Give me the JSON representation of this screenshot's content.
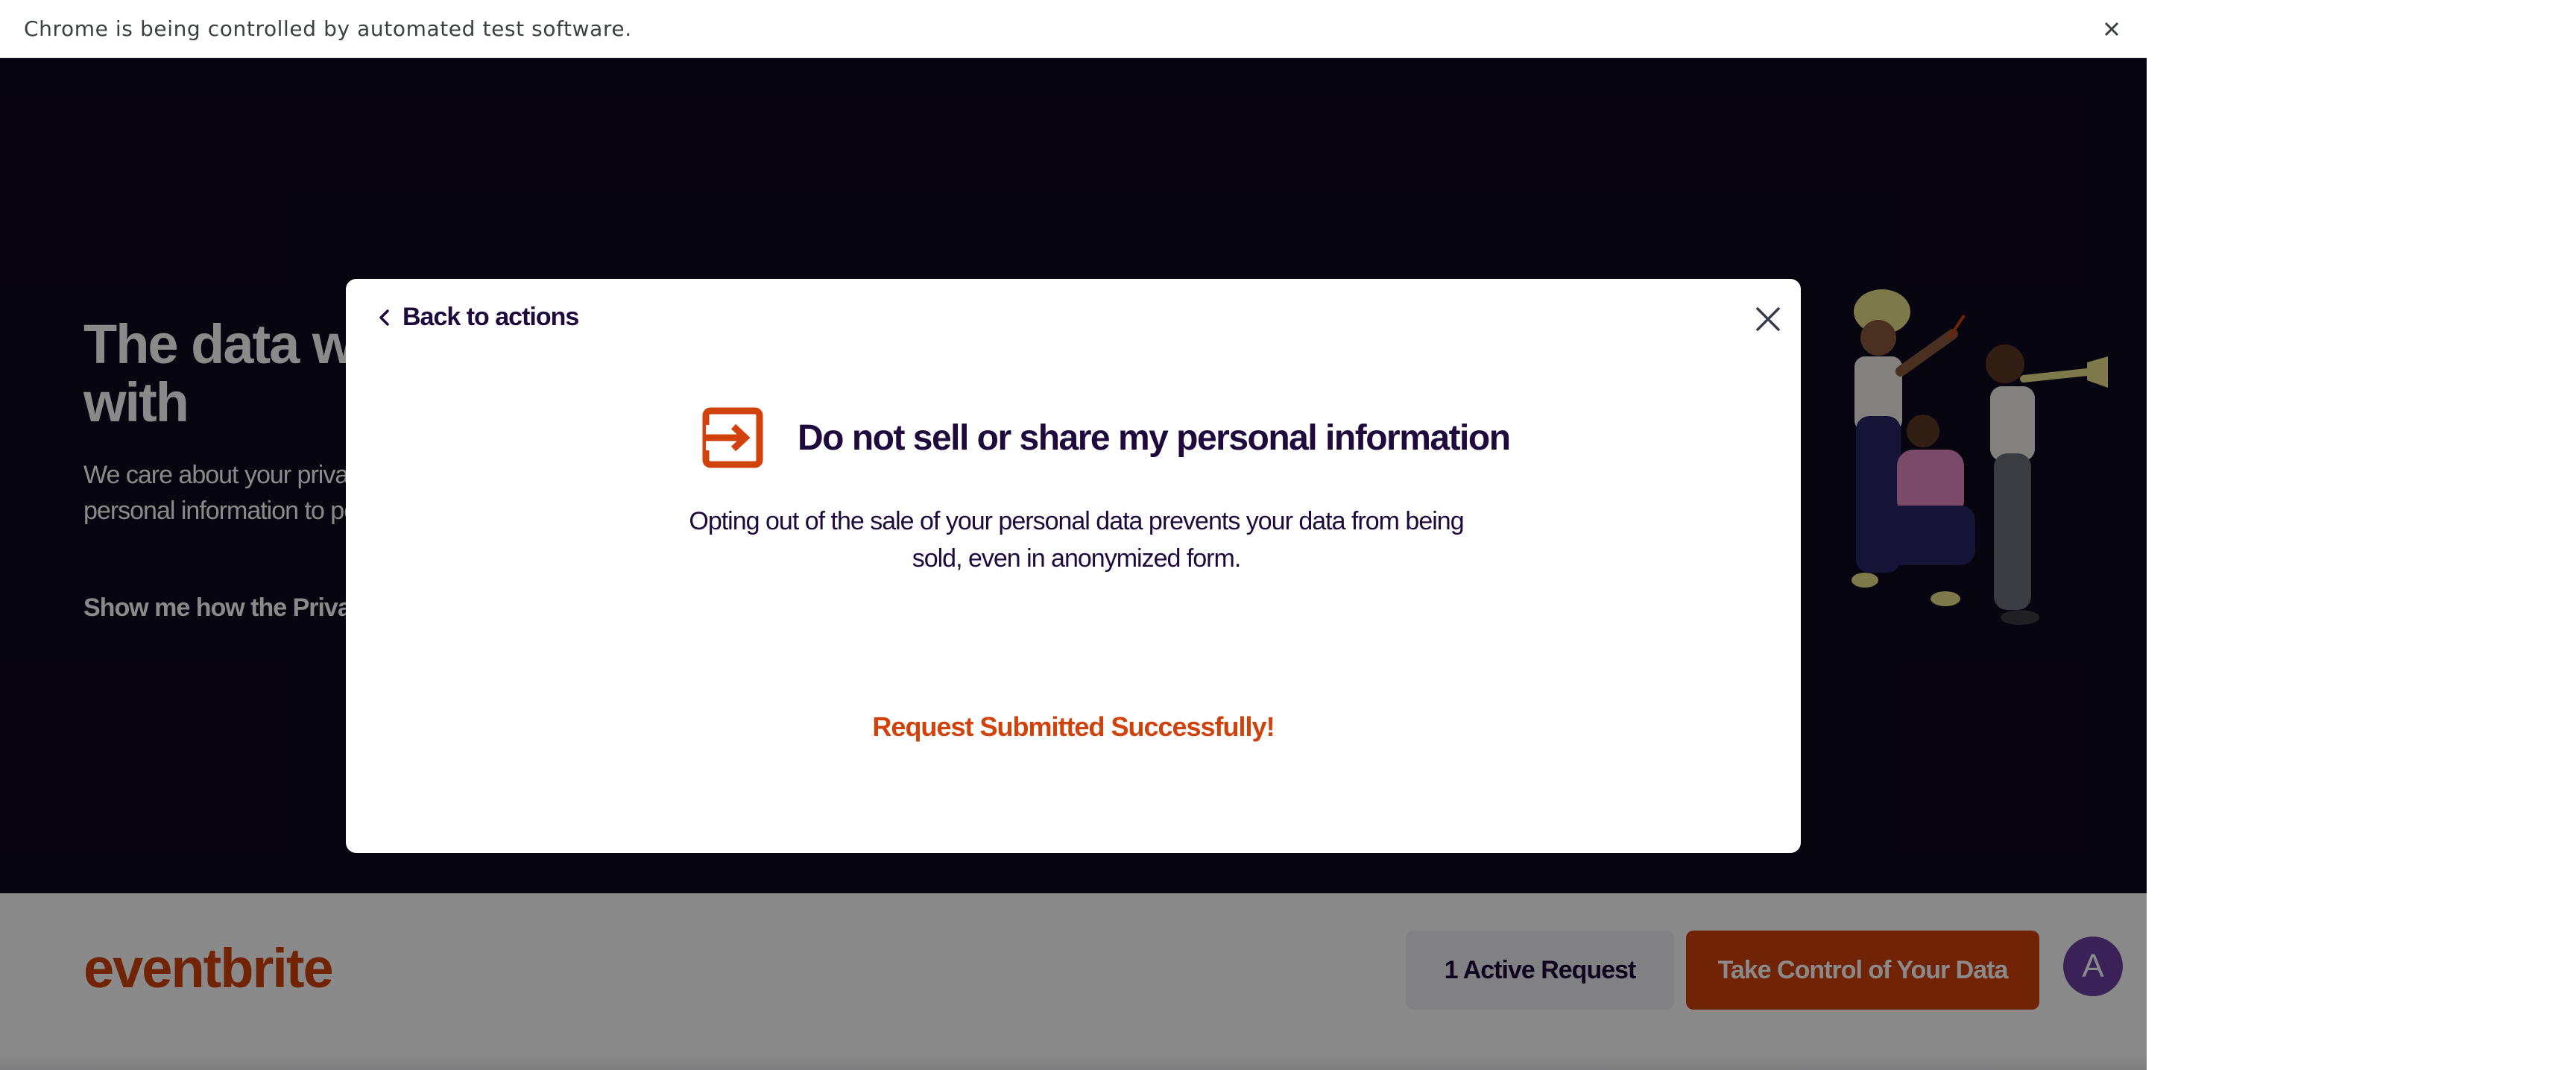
{
  "browser": {
    "infobar_text": "Chrome is being controlled by automated test software."
  },
  "hero": {
    "title": "The data we collect, who we share it with",
    "subtitle": "We care about your privacy. We collect and share your personal information to power \"Take Control of Your Data.\"",
    "link": "Show me how the Privacy Center works"
  },
  "site_header": {
    "logo": "eventbrite",
    "active_request_label": "1 Active Request",
    "take_control_label": "Take Control of Your Data",
    "avatar_initial": "A"
  },
  "modal": {
    "back_label": "Back to actions",
    "title": "Do not sell or share my personal information",
    "description": "Opting out of the sale of your personal data prevents your data from being sold, even in anonymized form.",
    "status": "Request Submitted Successfully!"
  },
  "colors": {
    "brand_orange": "#d1410c",
    "dark_navy": "#1e0a3c",
    "hero_bg": "#0e0a1f"
  },
  "icons": {
    "infobar_close": "close-icon",
    "back": "chevron-left-icon",
    "modal_close": "close-icon",
    "opt_out": "arrow-exit-icon"
  }
}
